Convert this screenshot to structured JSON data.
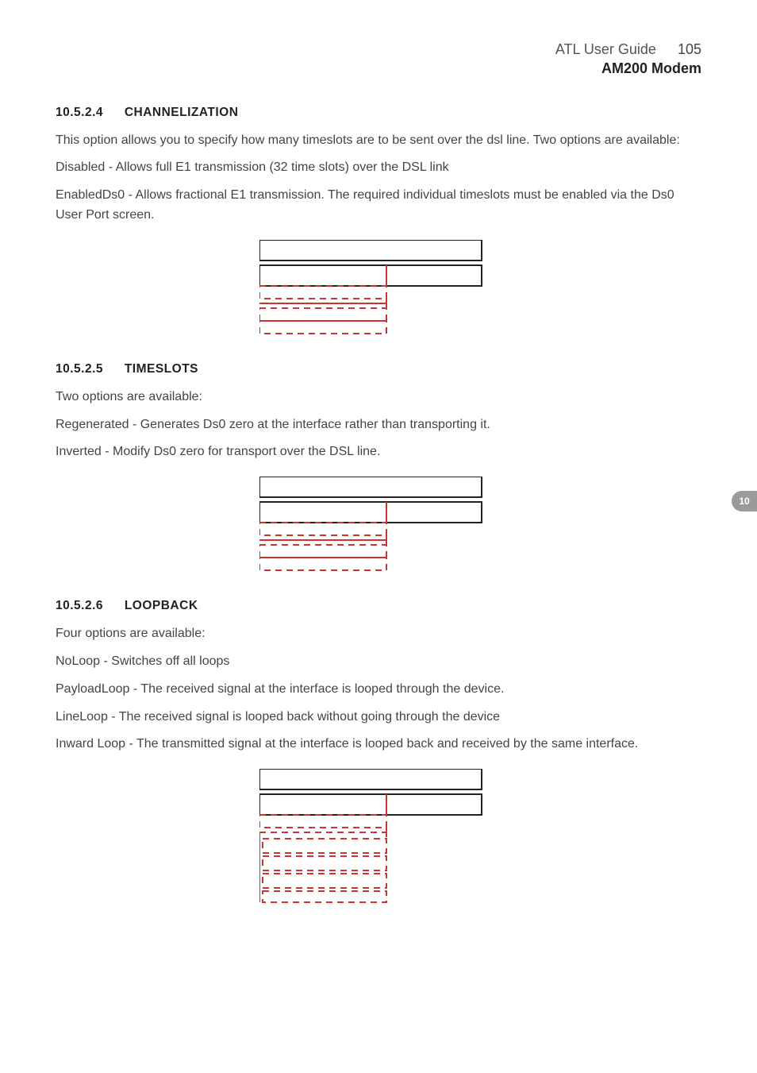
{
  "header": {
    "doc_title": "ATL User Guide",
    "page_number": "105",
    "subtitle": "AM200 Modem"
  },
  "sections": {
    "channelization": {
      "num": "10.5.2.4",
      "title": "CHANNELIZATION",
      "intro": "This option allows you to specify how many timeslots are to be sent over the dsl line. Two options are available:",
      "opt1": "Disabled - Allows full E1 transmission (32 time slots) over the DSL link",
      "opt2": "EnabledDs0 - Allows fractional E1 transmission. The required individual timeslots must be enabled via the Ds0 User Port screen."
    },
    "timeslots": {
      "num": "10.5.2.5",
      "title": "TIMESLOTS",
      "intro": "Two options are available:",
      "opt1": "Regenerated - Generates Ds0 zero at the interface rather than transporting it.",
      "opt2": "Inverted - Modify Ds0 zero for transport over the DSL line."
    },
    "loopback": {
      "num": "10.5.2.6",
      "title": "LOOPBACK",
      "intro": "Four options are available:",
      "opt1": "NoLoop - Switches off all loops",
      "opt2": "PayloadLoop - The received signal at the interface is looped through the device.",
      "opt3": "LineLoop - The received signal is looped back without going through the device",
      "opt4": "Inward Loop - The transmitted signal at the interface is looped back and received by the same interface."
    }
  },
  "side_tab": "10"
}
